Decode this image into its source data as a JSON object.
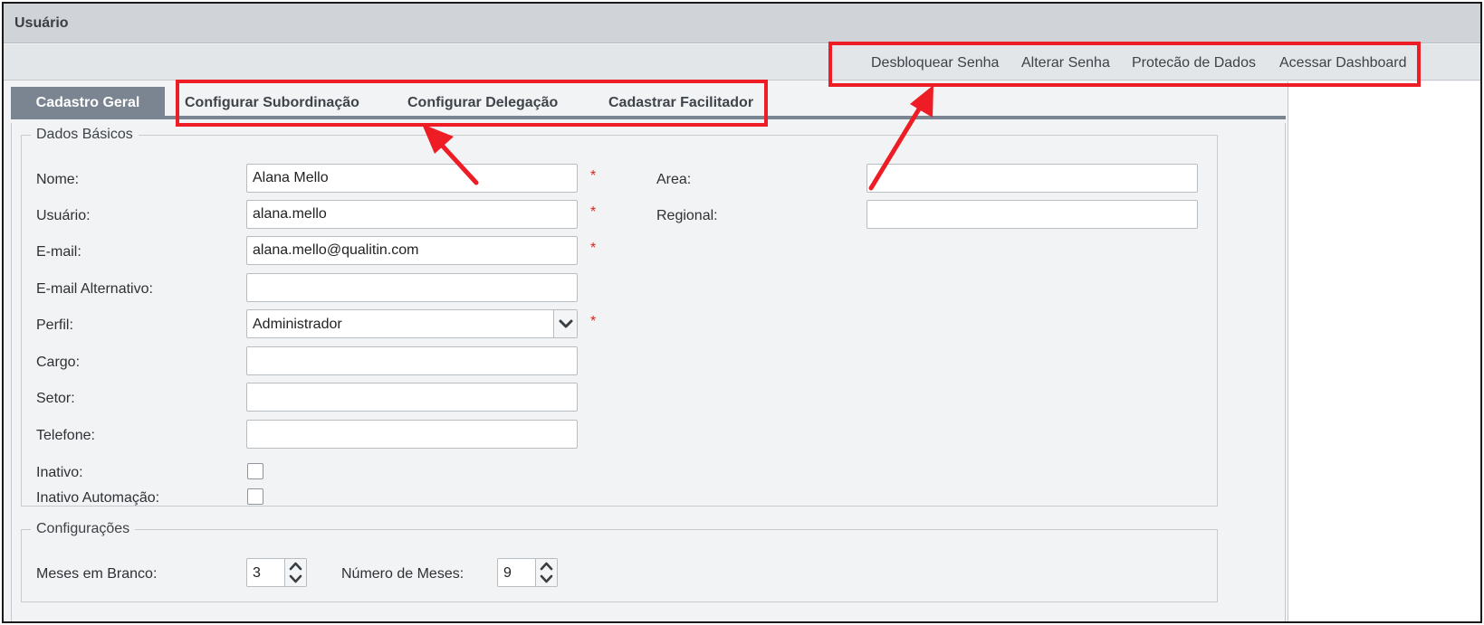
{
  "window": {
    "title": "Usuário"
  },
  "actions": [
    {
      "label": "Desbloquear Senha"
    },
    {
      "label": "Alterar Senha"
    },
    {
      "label": "Protecão de Dados"
    },
    {
      "label": "Acessar Dashboard"
    }
  ],
  "tabs": [
    {
      "label": "Cadastro Geral",
      "active": true
    },
    {
      "label": "Configurar Subordinação",
      "active": false
    },
    {
      "label": "Configurar Delegação",
      "active": false
    },
    {
      "label": "Cadastrar Facilitador",
      "active": false
    }
  ],
  "basic": {
    "legend": "Dados Básicos",
    "required_mark": "*",
    "nome": {
      "label": "Nome:",
      "value": "Alana Mello"
    },
    "usuario": {
      "label": "Usuário:",
      "value": "alana.mello"
    },
    "email": {
      "label": "E-mail:",
      "value": "alana.mello@qualitin.com"
    },
    "email_alt": {
      "label": "E-mail Alternativo:",
      "value": ""
    },
    "perfil": {
      "label": "Perfil:",
      "value": "Administrador"
    },
    "cargo": {
      "label": "Cargo:",
      "value": ""
    },
    "setor": {
      "label": "Setor:",
      "value": ""
    },
    "telefone": {
      "label": "Telefone:",
      "value": ""
    },
    "inativo": {
      "label": "Inativo:",
      "checked": false
    },
    "inativo_automacao": {
      "label": "Inativo Automação:",
      "checked": false
    },
    "area": {
      "label": "Area:",
      "value": ""
    },
    "regional": {
      "label": "Regional:",
      "value": ""
    }
  },
  "config": {
    "legend": "Configurações",
    "meses_branco": {
      "label": "Meses em Branco:",
      "value": "3"
    },
    "numero_meses": {
      "label": "Número de Meses:",
      "value": "9"
    }
  },
  "colors": {
    "annotation": "#ee1c24",
    "active_tab": "#7b8591",
    "required": "#e0201b"
  },
  "icons": {
    "dropdown": "chevron-down-icon",
    "spin_up": "chevron-up-icon",
    "spin_down": "chevron-down-icon",
    "annotation_arrow": "arrow-icon"
  }
}
